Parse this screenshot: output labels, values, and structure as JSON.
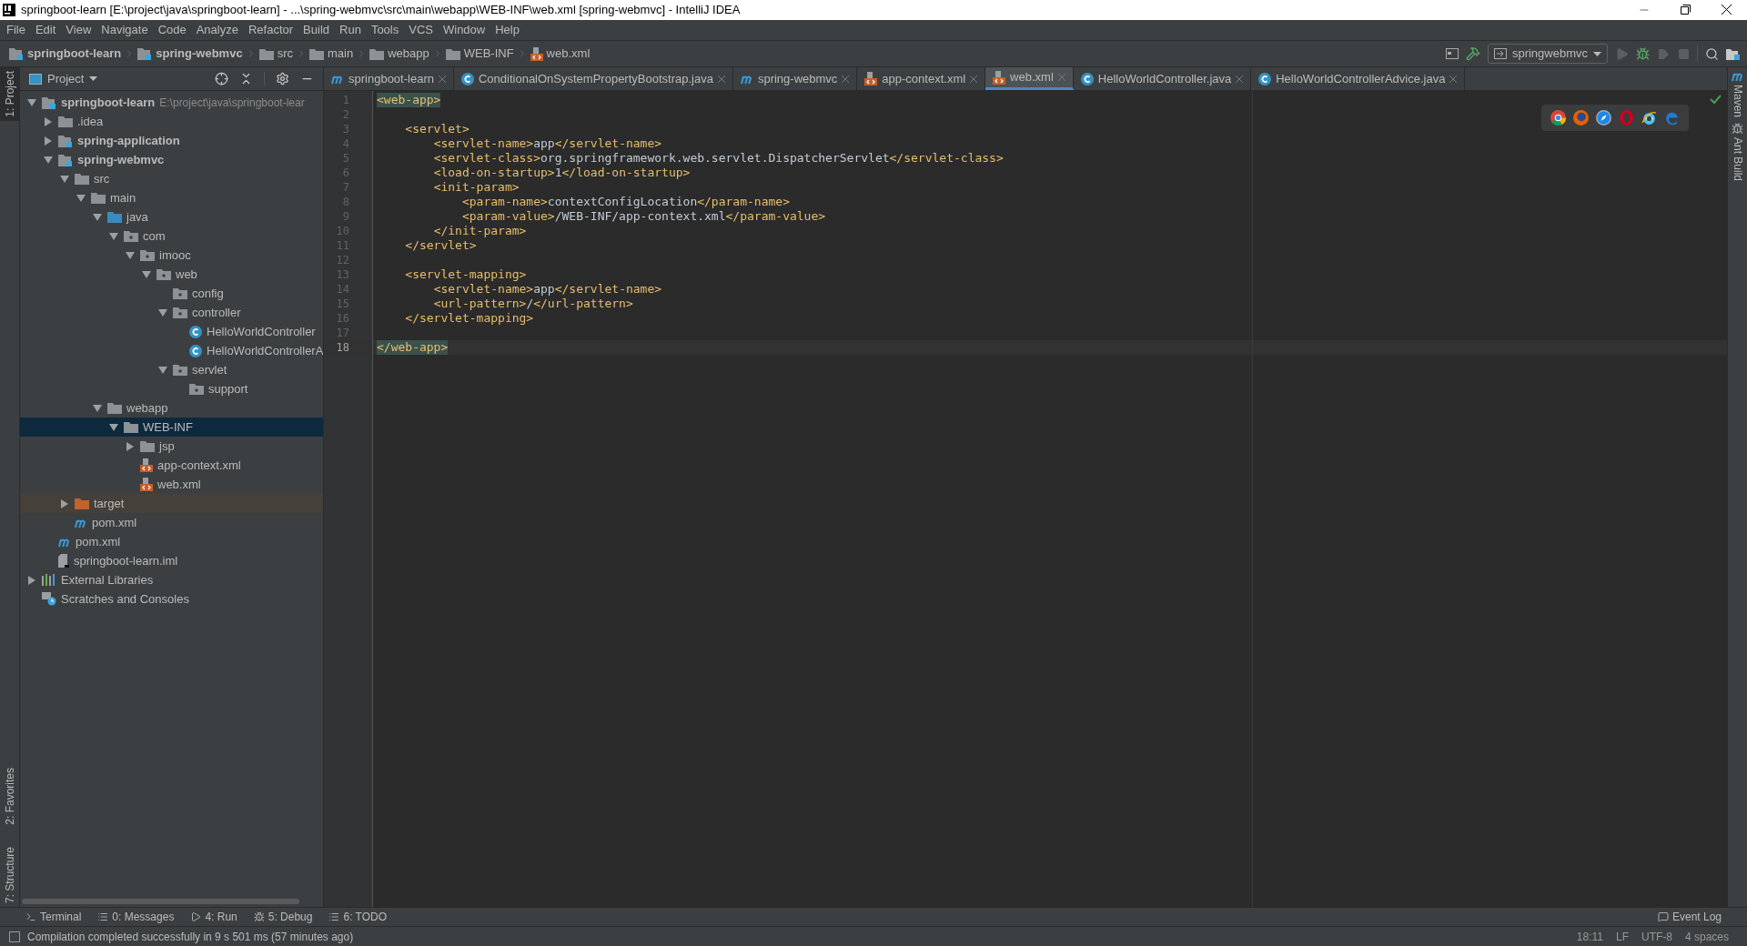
{
  "window": {
    "title": "springboot-learn [E:\\project\\java\\springboot-learn] - ...\\spring-webmvc\\src\\main\\webapp\\WEB-INF\\web.xml [spring-webmvc] - IntelliJ IDEA"
  },
  "menu": [
    "File",
    "Edit",
    "View",
    "Navigate",
    "Code",
    "Analyze",
    "Refactor",
    "Build",
    "Run",
    "Tools",
    "VCS",
    "Window",
    "Help"
  ],
  "breadcrumbs": [
    {
      "label": "springboot-learn",
      "kind": "module"
    },
    {
      "label": "spring-webmvc",
      "kind": "module"
    },
    {
      "label": "src",
      "kind": "folder"
    },
    {
      "label": "main",
      "kind": "folder"
    },
    {
      "label": "webapp",
      "kind": "folder"
    },
    {
      "label": "WEB-INF",
      "kind": "folder"
    },
    {
      "label": "web.xml",
      "kind": "xml"
    }
  ],
  "toolbar": {
    "run_config": "springwebmvc"
  },
  "left_stripe": [
    {
      "label": "1: Project",
      "selected": true
    },
    {
      "label": "2: Favorites",
      "selected": false
    },
    {
      "label": "7: Structure",
      "selected": false
    }
  ],
  "right_stripe": [
    "Maven",
    "Ant Build"
  ],
  "project_panel": {
    "title": "Project",
    "tree": [
      {
        "label": "springboot-learn",
        "kind": "module",
        "path": "E:\\project\\java\\springboot-lear",
        "expanded": true,
        "selected": false,
        "children": [
          {
            "label": ".idea",
            "kind": "folder",
            "expanded": false,
            "selected": false
          },
          {
            "label": "spring-application",
            "kind": "module",
            "expanded": false,
            "selected": false
          },
          {
            "label": "spring-webmvc",
            "kind": "module",
            "expanded": true,
            "selected": false,
            "children": [
              {
                "label": "src",
                "kind": "folder",
                "expanded": true,
                "selected": false,
                "children": [
                  {
                    "label": "main",
                    "kind": "folder",
                    "expanded": true,
                    "selected": false,
                    "children": [
                      {
                        "label": "java",
                        "kind": "source",
                        "expanded": true,
                        "selected": false,
                        "children": [
                          {
                            "label": "com",
                            "kind": "package",
                            "expanded": true,
                            "selected": false,
                            "children": [
                              {
                                "label": "imooc",
                                "kind": "package",
                                "expanded": true,
                                "selected": false,
                                "children": [
                                  {
                                    "label": "web",
                                    "kind": "package",
                                    "expanded": true,
                                    "selected": false,
                                    "children": [
                                      {
                                        "label": "config",
                                        "kind": "package",
                                        "selected": false
                                      },
                                      {
                                        "label": "controller",
                                        "kind": "package",
                                        "expanded": true,
                                        "selected": false,
                                        "children": [
                                          {
                                            "label": "HelloWorldController",
                                            "kind": "class",
                                            "selected": false
                                          },
                                          {
                                            "label": "HelloWorldControllerA",
                                            "kind": "class",
                                            "selected": false
                                          }
                                        ]
                                      },
                                      {
                                        "label": "servlet",
                                        "kind": "package",
                                        "expanded": true,
                                        "selected": false,
                                        "children": [
                                          {
                                            "label": "support",
                                            "kind": "package",
                                            "selected": false
                                          }
                                        ]
                                      }
                                    ]
                                  }
                                ]
                              }
                            ]
                          }
                        ]
                      },
                      {
                        "label": "webapp",
                        "kind": "folder",
                        "expanded": true,
                        "selected": false,
                        "children": [
                          {
                            "label": "WEB-INF",
                            "kind": "folder",
                            "expanded": true,
                            "selected": true,
                            "children": [
                              {
                                "label": "jsp",
                                "kind": "folder",
                                "expanded": false,
                                "selected": false
                              },
                              {
                                "label": "app-context.xml",
                                "kind": "xml",
                                "selected": false
                              },
                              {
                                "label": "web.xml",
                                "kind": "xml",
                                "selected": false
                              }
                            ]
                          }
                        ]
                      }
                    ]
                  }
                ]
              },
              {
                "label": "target",
                "kind": "excluded",
                "expanded": false,
                "selected": false
              },
              {
                "label": "pom.xml",
                "kind": "maven",
                "selected": false
              }
            ]
          },
          {
            "label": "pom.xml",
            "kind": "maven",
            "selected": false
          },
          {
            "label": "springboot-learn.iml",
            "kind": "iml",
            "selected": false
          }
        ]
      },
      {
        "label": "External Libraries",
        "kind": "libraries",
        "expanded": false,
        "selected": false
      },
      {
        "label": "Scratches and Consoles",
        "kind": "scratches",
        "selected": false
      }
    ]
  },
  "editor": {
    "tabs": [
      {
        "label": "springboot-learn",
        "kind": "maven",
        "selected": false
      },
      {
        "label": "ConditionalOnSystemPropertyBootstrap.java",
        "kind": "class",
        "selected": false
      },
      {
        "label": "spring-webmvc",
        "kind": "maven",
        "selected": false
      },
      {
        "label": "app-context.xml",
        "kind": "xml",
        "selected": false
      },
      {
        "label": "web.xml",
        "kind": "xml",
        "selected": true
      },
      {
        "label": "HelloWorldController.java",
        "kind": "class",
        "selected": false
      },
      {
        "label": "HelloWorldControllerAdvice.java",
        "kind": "class",
        "selected": false
      }
    ],
    "lines": [
      {
        "number": "1",
        "code": "<web-app>",
        "matched": true,
        "current": false
      },
      {
        "number": "2",
        "matched": false,
        "current": false
      },
      {
        "number": "3",
        "code": "    <servlet>",
        "matched": false,
        "current": false
      },
      {
        "number": "4",
        "code": "        <servlet-name>app</servlet-name>",
        "matched": false,
        "current": false
      },
      {
        "number": "5",
        "code": "        <servlet-class>org.springframework.web.servlet.DispatcherServlet</servlet-class>",
        "matched": false,
        "current": false
      },
      {
        "number": "6",
        "code": "        <load-on-startup>1</load-on-startup>",
        "matched": false,
        "current": false
      },
      {
        "number": "7",
        "code": "        <init-param>",
        "matched": false,
        "current": false
      },
      {
        "number": "8",
        "code": "            <param-name>contextConfigLocation</param-name>",
        "matched": false,
        "current": false
      },
      {
        "number": "9",
        "code": "            <param-value>/WEB-INF/app-context.xml</param-value>",
        "matched": false,
        "current": false
      },
      {
        "number": "10",
        "code": "        </init-param>",
        "matched": false,
        "current": false
      },
      {
        "number": "11",
        "code": "    </servlet>",
        "matched": false,
        "current": false
      },
      {
        "number": "12",
        "matched": false,
        "current": false
      },
      {
        "number": "13",
        "code": "    <servlet-mapping>",
        "matched": false,
        "current": false
      },
      {
        "number": "14",
        "code": "        <servlet-name>app</servlet-name>",
        "matched": false,
        "current": false
      },
      {
        "number": "15",
        "code": "        <url-pattern>/</url-pattern>",
        "matched": false,
        "current": false
      },
      {
        "number": "16",
        "code": "    </servlet-mapping>",
        "matched": false,
        "current": false
      },
      {
        "number": "17",
        "matched": false,
        "current": false
      },
      {
        "number": "18",
        "code": "</web-app>",
        "matched": true,
        "current": true
      }
    ]
  },
  "bottom_tools": [
    "Terminal",
    "0: Messages",
    "4: Run",
    "5: Debug",
    "6: TODO"
  ],
  "event_log": "Event Log",
  "status_bar": {
    "message": "Compilation completed successfully in 9 s 501 ms (57 minutes ago)",
    "items": [
      "18:11",
      "LF",
      "UTF-8",
      "4 spaces"
    ]
  }
}
